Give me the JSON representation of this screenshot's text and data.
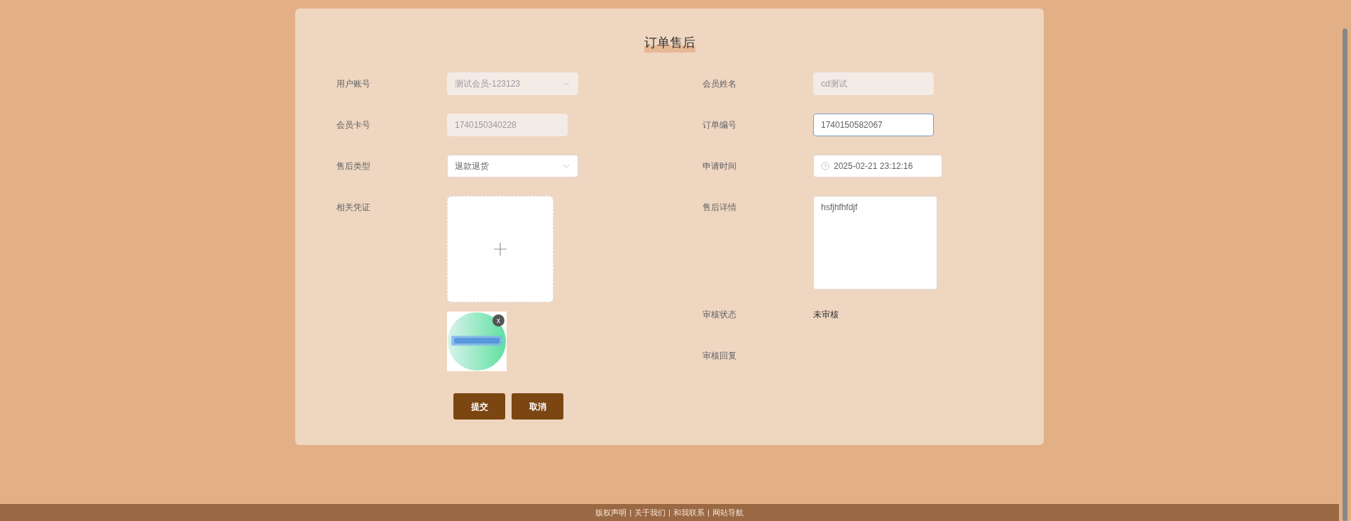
{
  "title": "订单售后",
  "left_fields": [
    {
      "label": "用户账号",
      "kind": "select",
      "value": "测试会员-123123",
      "disabled": true
    },
    {
      "label": "会员卡号",
      "kind": "input",
      "value": "1740150340228",
      "disabled": true
    },
    {
      "label": "售后类型",
      "kind": "select",
      "value": "退款退货",
      "disabled": false
    },
    {
      "label": "相关凭证",
      "kind": "upload",
      "images": [
        {
          "kind": "picture",
          "remove": "x"
        }
      ]
    }
  ],
  "right_fields": [
    {
      "label": "会员姓名",
      "kind": "input",
      "value": "cd测试",
      "disabled": true,
      "focused": false
    },
    {
      "label": "订单编号",
      "kind": "input",
      "value": "1740150582067",
      "disabled": false,
      "focused": true
    },
    {
      "label": "申请时间",
      "kind": "date",
      "value": "2025-02-21 23:12:16"
    },
    {
      "label": "售后详情",
      "kind": "textarea",
      "value": "hsfjhfhfdjf"
    },
    {
      "label": "审核状态",
      "kind": "text",
      "value": "未审核"
    },
    {
      "label": "审核回复",
      "kind": "text"
    }
  ],
  "buttons": [
    "提交",
    "取消"
  ],
  "footer": {
    "separator": "|",
    "links": [
      "版权声明",
      "关于我们",
      "和我联系",
      "网站导航"
    ]
  }
}
